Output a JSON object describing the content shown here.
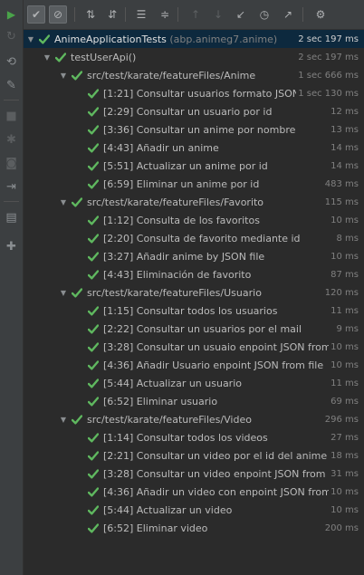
{
  "sidebar": {
    "icons": [
      "run-icon",
      "rerun-icon",
      "toggle-auto-test-icon",
      "settings-wrench-icon",
      "stop-icon",
      "debug-icon",
      "camera-icon",
      "exit-icon",
      "layout-icon",
      "pin-icon"
    ]
  },
  "toolbar": {
    "buttons": [
      {
        "name": "show-passed-button",
        "glyph": "✔",
        "state": "pressed"
      },
      {
        "name": "show-ignored-button",
        "glyph": "⊘",
        "state": "pressed"
      },
      {
        "name": "sort-alphabetically-button",
        "glyph": "⇅",
        "state": "normal"
      },
      {
        "name": "sort-by-duration-button",
        "glyph": "⇵",
        "state": "normal"
      },
      {
        "name": "expand-all-button",
        "glyph": "☰",
        "state": "normal"
      },
      {
        "name": "collapse-all-button",
        "glyph": "≑",
        "state": "normal"
      },
      {
        "name": "previous-failed-button",
        "glyph": "↑",
        "state": "disabled"
      },
      {
        "name": "next-failed-button",
        "glyph": "↓",
        "state": "disabled"
      },
      {
        "name": "import-tests-button",
        "glyph": "↙",
        "state": "normal"
      },
      {
        "name": "test-history-button",
        "glyph": "◷",
        "state": "normal"
      },
      {
        "name": "export-tests-button",
        "glyph": "↗",
        "state": "normal"
      },
      {
        "name": "settings-button",
        "glyph": "⚙",
        "state": "normal"
      }
    ]
  },
  "colors": {
    "pass": "#5fb85f",
    "selected": "#0d293e",
    "background": "#2b2b2b",
    "toolbar": "#3c3f41"
  },
  "tree": {
    "root": {
      "label": "AnimeApplicationTests",
      "suffix": "(abp.animeg7.anime)",
      "duration": "2 sec 197 ms"
    },
    "method": {
      "label": "testUserApi()",
      "duration": "2 sec 197 ms"
    },
    "groups": [
      {
        "label": "src/test/karate/featureFiles/Anime",
        "duration": "1 sec 666 ms",
        "tests": [
          {
            "label": "[1:21] Consultar usuarios formato JSON",
            "duration": "1 sec 130 ms"
          },
          {
            "label": "[2:29] Consultar un usuario por id",
            "duration": "12 ms"
          },
          {
            "label": "[3:36] Consultar un anime por nombre",
            "duration": "13 ms"
          },
          {
            "label": "[4:43] Añadir un anime",
            "duration": "14 ms"
          },
          {
            "label": "[5:51] Actualizar un anime por id",
            "duration": "14 ms"
          },
          {
            "label": "[6:59] Eliminar un anime por id",
            "duration": "483 ms"
          }
        ]
      },
      {
        "label": "src/test/karate/featureFiles/Favorito",
        "duration": "115 ms",
        "tests": [
          {
            "label": "[1:12] Consulta de los favoritos",
            "duration": "10 ms"
          },
          {
            "label": "[2:20] Consulta de favorito mediante id",
            "duration": "8 ms"
          },
          {
            "label": "[3:27] Añadir anime by JSON file",
            "duration": "10 ms"
          },
          {
            "label": "[4:43] Eliminación de favorito",
            "duration": "87 ms"
          }
        ]
      },
      {
        "label": "src/test/karate/featureFiles/Usuario",
        "duration": "120 ms",
        "tests": [
          {
            "label": "[1:15] Consultar todos los usuarios",
            "duration": "11 ms"
          },
          {
            "label": "[2:22] Consultar un usuarios por el mail",
            "duration": "9 ms"
          },
          {
            "label": "[3:28] Consultar un usuaio enpoint JSON from",
            "duration": "10 ms"
          },
          {
            "label": "[4:36] Añadir Usuario enpoint JSON from file",
            "duration": "10 ms"
          },
          {
            "label": "[5:44] Actualizar un usuario",
            "duration": "11 ms"
          },
          {
            "label": "[6:52] Eliminar usuario",
            "duration": "69 ms"
          }
        ]
      },
      {
        "label": "src/test/karate/featureFiles/Video",
        "duration": "296 ms",
        "tests": [
          {
            "label": "[1:14] Consultar todos los videos",
            "duration": "27 ms"
          },
          {
            "label": "[2:21] Consultar un video por el id del anime",
            "duration": "18 ms"
          },
          {
            "label": "[3:28] Consultar un video enpoint JSON from",
            "duration": "31 ms"
          },
          {
            "label": "[4:36] Añadir un video con enpoint JSON from",
            "duration": "10 ms"
          },
          {
            "label": "[5:44] Actualizar un video",
            "duration": "10 ms"
          },
          {
            "label": "[6:52] Eliminar video",
            "duration": "200 ms"
          }
        ]
      }
    ]
  }
}
